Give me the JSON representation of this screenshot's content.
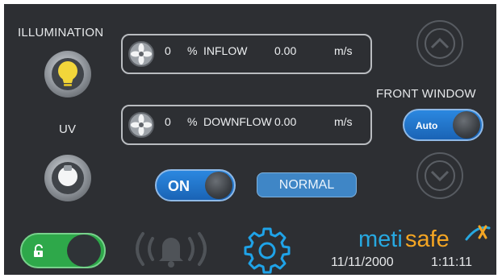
{
  "illumination": {
    "label": "ILLUMINATION",
    "icon": "lightbulb-icon",
    "color": "#f2d63a"
  },
  "uv": {
    "label": "UV",
    "icon": "uv-lamp-icon"
  },
  "inflow": {
    "percent": "0",
    "percent_unit": "%",
    "name": "INFLOW",
    "speed": "0.00",
    "speed_unit": "m/s",
    "icon": "fan-icon"
  },
  "downflow": {
    "percent": "0",
    "percent_unit": "%",
    "name": "DOWNFLOW",
    "speed": "0.00",
    "speed_unit": "m/s",
    "icon": "fan-icon"
  },
  "power_toggle": {
    "label": "ON",
    "color": "#1f78d1"
  },
  "status_badge": {
    "label": "NORMAL",
    "color": "#3f86c6"
  },
  "front_window": {
    "label": "FRONT WINDOW",
    "mode_label": "Auto",
    "up_icon": "chevron-up-icon",
    "down_icon": "chevron-down-icon"
  },
  "lock_toggle": {
    "icon": "unlock-icon",
    "color": "#2ea84a"
  },
  "alarm": {
    "icon": "bell-icon"
  },
  "settings": {
    "icon": "gear-icon",
    "color": "#1fa3e8"
  },
  "brand": {
    "name_part1": "meti",
    "name_part2": "safe",
    "color1": "#27a8e0",
    "color2": "#f5a623"
  },
  "datetime": {
    "date": "11/11/2000",
    "time": "1:11:11"
  }
}
